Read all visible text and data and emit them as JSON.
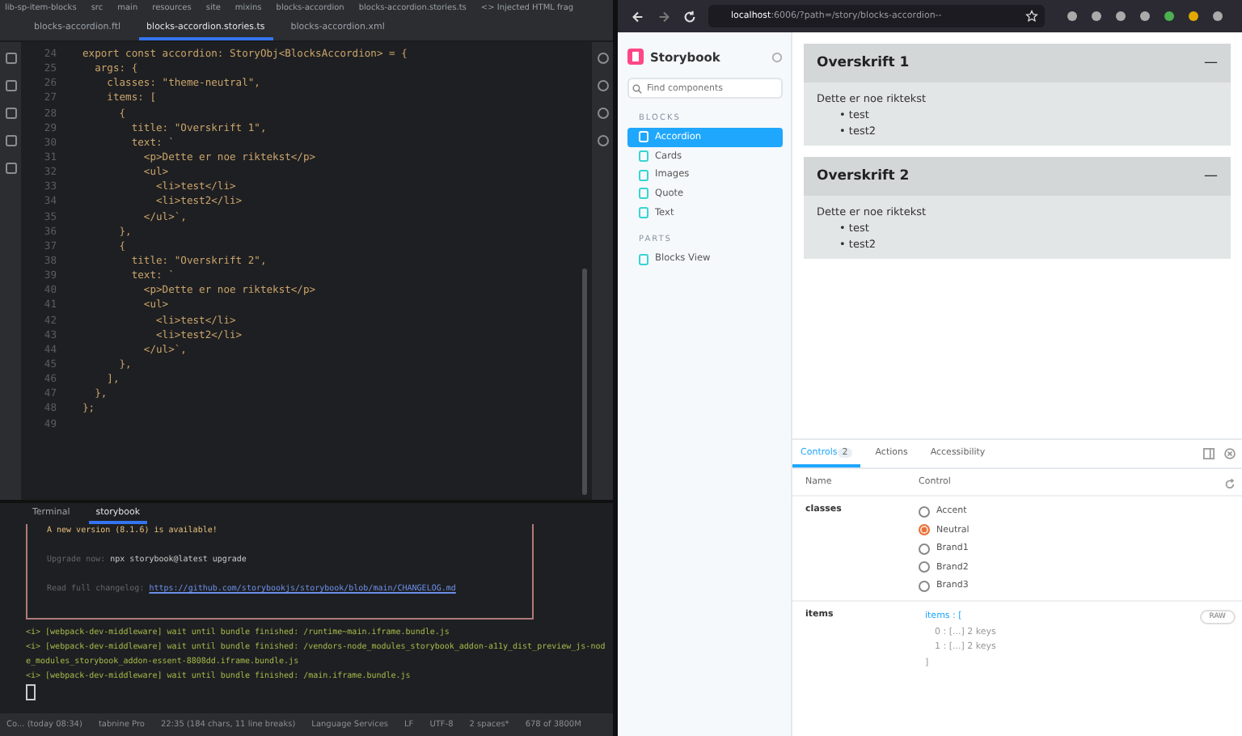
{
  "ide": {
    "breadcrumbs": [
      "lib-sp-item-blocks",
      "src",
      "main",
      "resources",
      "site",
      "mixins",
      "blocks-accordion",
      "blocks-accordion.stories.ts",
      "<> Injected HTML frag"
    ],
    "tabs": [
      {
        "label": "blocks-accordion.ftl",
        "selected": false
      },
      {
        "label": "blocks-accordion.stories.ts",
        "selected": true
      },
      {
        "label": "blocks-accordion.xml",
        "selected": false
      }
    ],
    "code_lines": [
      {
        "number": "24",
        "text": "export const accordion: StoryObj<BlocksAccordion> = {"
      },
      {
        "number": "25",
        "text": "  args: {"
      },
      {
        "number": "26",
        "text": "    classes: \"theme-neutral\","
      },
      {
        "number": "27",
        "text": "    items: ["
      },
      {
        "number": "28",
        "text": "      {"
      },
      {
        "number": "29",
        "text": "        title: \"Overskrift 1\","
      },
      {
        "number": "30",
        "text": "        text: `"
      },
      {
        "number": "31",
        "text": "          <p>Dette er noe riktekst</p>"
      },
      {
        "number": "32",
        "text": "          <ul>"
      },
      {
        "number": "33",
        "text": "            <li>test</li>"
      },
      {
        "number": "34",
        "text": "            <li>test2</li>"
      },
      {
        "number": "35",
        "text": "          </ul>`,"
      },
      {
        "number": "36",
        "text": "      },"
      },
      {
        "number": "37",
        "text": "      {"
      },
      {
        "number": "38",
        "text": "        title: \"Overskrift 2\","
      },
      {
        "number": "39",
        "text": "        text: `"
      },
      {
        "number": "40",
        "text": "          <p>Dette er noe riktekst</p>"
      },
      {
        "number": "41",
        "text": "          <ul>"
      },
      {
        "number": "42",
        "text": "            <li>test</li>"
      },
      {
        "number": "43",
        "text": "            <li>test2</li>"
      },
      {
        "number": "44",
        "text": "          </ul>`,"
      },
      {
        "number": "45",
        "text": "      },"
      },
      {
        "number": "46",
        "text": "    ],"
      },
      {
        "number": "47",
        "text": "  },"
      },
      {
        "number": "48",
        "text": "};"
      },
      {
        "number": "49"
      }
    ],
    "terminal": {
      "tabs": [
        {
          "label": "Terminal",
          "selected": false
        },
        {
          "label": "storybook",
          "selected": true
        }
      ],
      "notice": {
        "headline": "A new version (8.1.6) is available!",
        "upgrade_label": "Upgrade now:",
        "upgrade_command": "npx storybook@latest upgrade",
        "changelog_label": "Read full changelog:",
        "changelog_link": "https://github.com/storybookjs/storybook/blob/main/CHANGELOG.md"
      },
      "log_lines": [
        {
          "tag": "<i>",
          "text": "[webpack-dev-middleware] wait until bundle finished: /runtime~main.iframe.bundle.js"
        },
        {
          "tag": "<i>",
          "text": "[webpack-dev-middleware] wait until bundle finished: /vendors-node_modules_storybook_addon-a11y_dist_preview_js-node_modules_storybook_addon-essent-8808dd.iframe.bundle.js"
        },
        {
          "tag": "<i>",
          "text": "[webpack-dev-middleware] wait until bundle finished: /main.iframe.bundle.js"
        }
      ]
    },
    "status_bar": [
      "Co... (today 08:34)",
      "tabnine Pro",
      "22:35 (184 chars, 11 line breaks)",
      "Language Services",
      "LF",
      "UTF-8",
      "2 spaces*",
      "678 of 3800M"
    ]
  },
  "browser": {
    "url_host": "localhost",
    "url_rest": ":6006/?path=/story/blocks-accordion--",
    "sidebar": {
      "brand": "Storybook",
      "search": {
        "placeholder": "Find components"
      },
      "groups": [
        {
          "label": "BLOCKS",
          "items": [
            {
              "label": "Accordion",
              "selected": true
            },
            {
              "label": "Cards",
              "selected": false
            },
            {
              "label": "Images",
              "selected": false
            },
            {
              "label": "Quote",
              "selected": false
            },
            {
              "label": "Text",
              "selected": false
            }
          ]
        },
        {
          "label": "PARTS",
          "items": [
            {
              "label": "Blocks View",
              "selected": false
            }
          ]
        }
      ]
    },
    "accordion": [
      {
        "title": "Overskrift 1",
        "toggle": "—",
        "text": "Dette er noe riktekst",
        "list": [
          {
            "bullet": "•",
            "text": "test"
          },
          {
            "bullet": "•",
            "text": "test2"
          }
        ]
      },
      {
        "title": "Overskrift 2",
        "toggle": "—",
        "text": "Dette er noe riktekst",
        "list": [
          {
            "bullet": "•",
            "text": "test"
          },
          {
            "bullet": "•",
            "text": "test2"
          }
        ]
      }
    ],
    "addons": {
      "tabs": [
        {
          "label": "Controls",
          "badge": "2",
          "selected": true
        },
        {
          "label": "Actions",
          "selected": false
        },
        {
          "label": "Accessibility",
          "selected": false
        }
      ],
      "columns": [
        "Name",
        "Control"
      ],
      "classes": {
        "name": "classes",
        "options": [
          {
            "label": "Accent",
            "selected": false
          },
          {
            "label": "Neutral",
            "selected": true
          },
          {
            "label": "Brand1",
            "selected": false
          },
          {
            "label": "Brand2",
            "selected": false
          },
          {
            "label": "Brand3",
            "selected": false
          }
        ]
      },
      "items": {
        "name": "items",
        "tree_root": "items : [",
        "tree_children": [
          "0 : [...] 2 keys",
          "1 : [...] 2 keys"
        ],
        "tree_end": "]",
        "raw_button": "RAW"
      }
    }
  }
}
